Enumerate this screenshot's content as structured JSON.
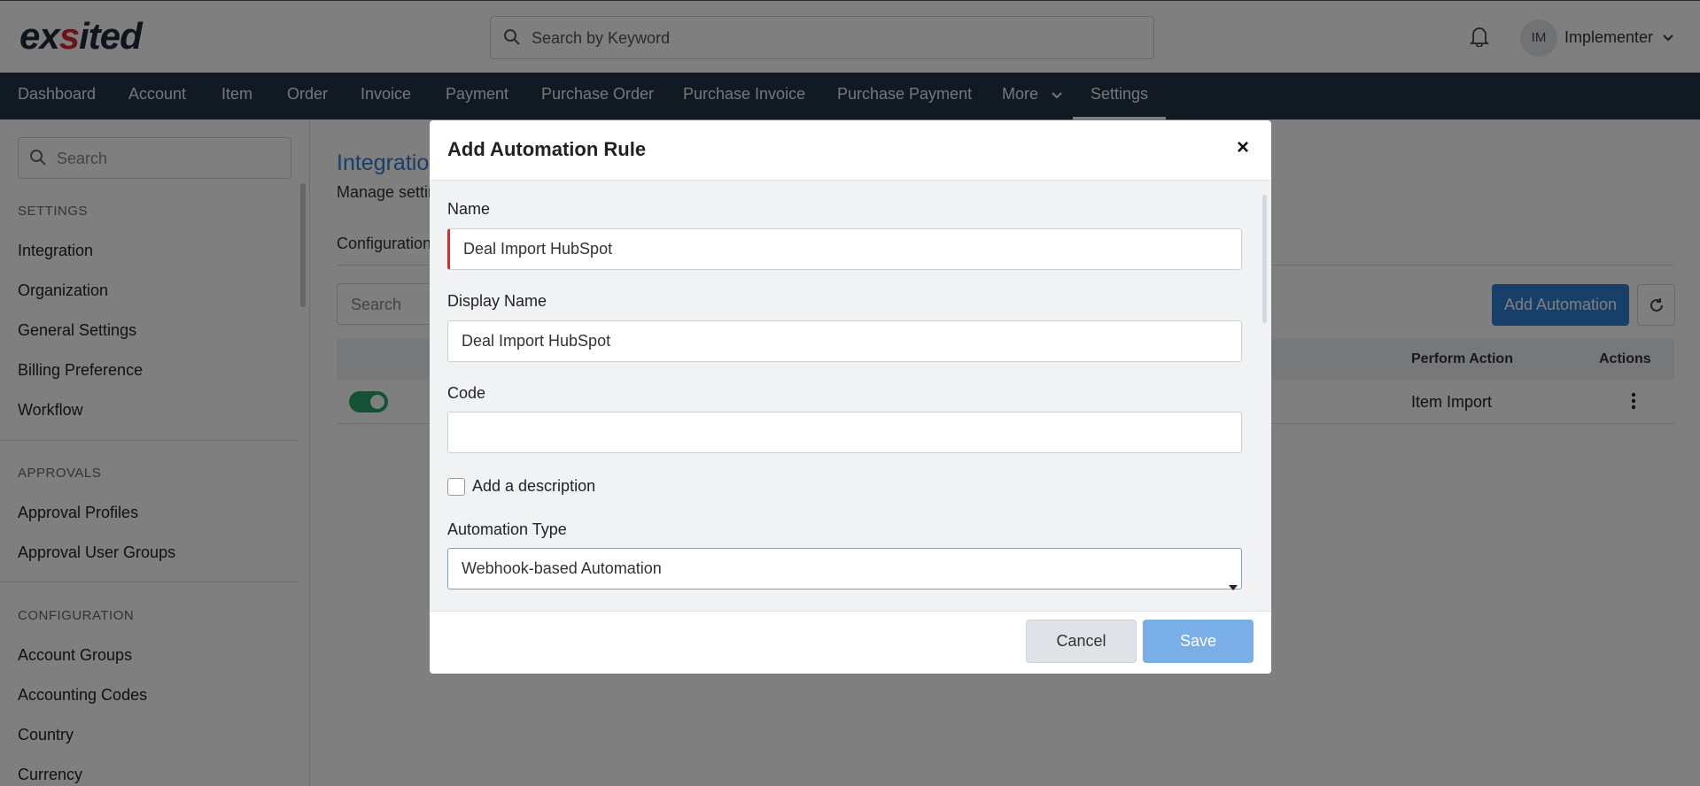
{
  "app": {
    "logo_text_start": "ex",
    "logo_text_accent": "s",
    "logo_text_end": "ited"
  },
  "header": {
    "search_placeholder": "Search by Keyword",
    "avatar_initials": "IM",
    "user_name": "Implementer"
  },
  "nav": {
    "items": [
      "Dashboard",
      "Account",
      "Item",
      "Order",
      "Invoice",
      "Payment",
      "Purchase Order",
      "Purchase Invoice",
      "Purchase Payment",
      "More",
      "Settings"
    ],
    "active": "Settings"
  },
  "sidebar": {
    "search_placeholder": "Search",
    "sections": [
      {
        "heading": "SETTINGS",
        "items": [
          "Integration",
          "Organization",
          "General Settings",
          "Billing Preference",
          "Workflow"
        ]
      },
      {
        "heading": "APPROVALS",
        "items": [
          "Approval Profiles",
          "Approval User Groups"
        ]
      },
      {
        "heading": "CONFIGURATION",
        "items": [
          "Account Groups",
          "Accounting Codes",
          "Country",
          "Currency"
        ]
      }
    ]
  },
  "main": {
    "title": "Integratio",
    "subtitle": "Manage settir",
    "tab": "Configuration",
    "search_placeholder": "Search",
    "add_button": "Add Automation",
    "table": {
      "headers": [
        "Perform Action",
        "Actions"
      ],
      "rows": [
        {
          "enabled": true,
          "perform_action": "Item Import"
        }
      ]
    }
  },
  "modal": {
    "title": "Add Automation Rule",
    "close_label": "×",
    "fields": {
      "name_label": "Name",
      "name_value": "Deal Import HubSpot",
      "display_name_label": "Display Name",
      "display_name_value": "Deal Import HubSpot",
      "code_label": "Code",
      "code_value": "",
      "description_checkbox_label": "Add a description",
      "description_checked": false,
      "automation_type_label": "Automation Type",
      "automation_type_value": "Webhook-based Automation"
    },
    "cancel_label": "Cancel",
    "save_label": "Save"
  },
  "colors": {
    "nav_bg": "#233447",
    "accent": "#2f7fd0",
    "toggle_on": "#27a46b",
    "error": "#d32f2f",
    "save_disabled": "#79aee6"
  }
}
